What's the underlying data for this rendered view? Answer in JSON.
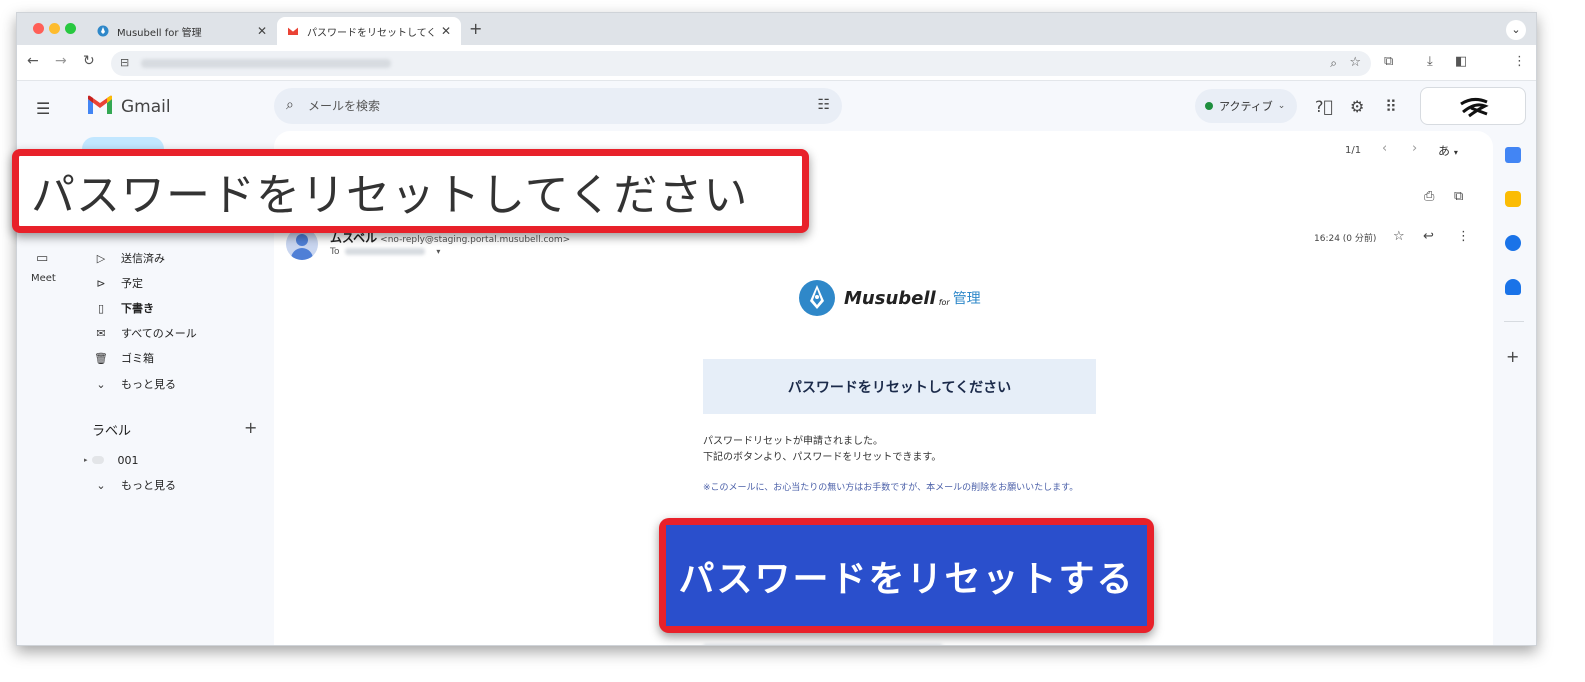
{
  "browser": {
    "tabs": [
      {
        "title": "Musubell for 管理",
        "active": false
      },
      {
        "title": "パスワードをリセットしてくださ",
        "active": true
      }
    ]
  },
  "gmail": {
    "logo_text": "Gmail",
    "search_placeholder": "メールを検索",
    "status": "アクティブ",
    "rail": {
      "meet_label": "Meet"
    },
    "nav": [
      {
        "label": "送信済み",
        "icon": "send-icon",
        "bold": false
      },
      {
        "label": "予定",
        "icon": "scheduled-icon",
        "bold": false
      },
      {
        "label": "下書き",
        "icon": "draft-icon",
        "bold": true
      },
      {
        "label": "すべてのメール",
        "icon": "all-mail-icon",
        "bold": false
      },
      {
        "label": "ゴミ箱",
        "icon": "trash-icon",
        "bold": false
      },
      {
        "label": "もっと見る",
        "icon": "chevron-down-icon",
        "bold": false
      }
    ],
    "labels_header": "ラベル",
    "labels": [
      {
        "label": "001"
      },
      {
        "label": "もっと見る"
      }
    ],
    "pager": "1/1",
    "language_button": "あ",
    "message": {
      "sender_name": "ムスベル",
      "sender_email": "<no-reply@staging.portal.musubell.com>",
      "to_label": "To",
      "time": "16:24 (0 分前)",
      "brand_name": "Musubell",
      "brand_for": "for",
      "brand_kanri": "管理",
      "title": "パスワードをリセットしてください",
      "body_lines": [
        "パスワードリセットが申請されました。",
        "下記のボタンより、パスワードをリセットできます。"
      ],
      "note": "※このメールに、お心当たりの無い方はお手数ですが、本メールの削除をお願いいたします。"
    }
  },
  "callouts": {
    "title": "パスワードをリセットしてください",
    "button": "パスワードをリセットする"
  },
  "colors": {
    "callout_border": "#e8212a",
    "button_blue": "#2a4fcc",
    "title_box_bg": "#e6eef8",
    "brand_blue": "#2f88c9"
  }
}
